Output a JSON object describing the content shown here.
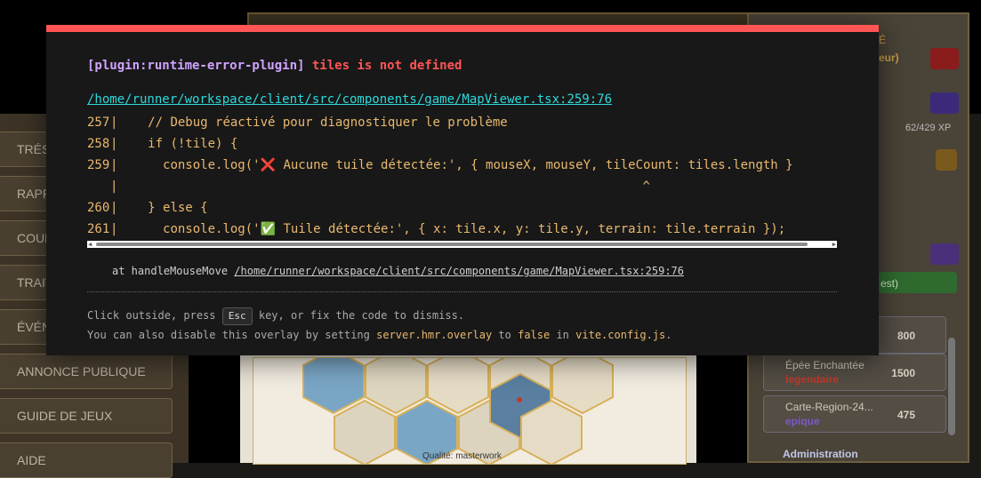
{
  "overlay": {
    "plugin": "[plugin:runtime-error-plugin]",
    "message": "tiles is not defined",
    "file": "/home/runner/workspace/client/src/components/game/MapViewer.tsx:259:76",
    "code_lines": [
      {
        "num": "257",
        "text": "    // Debug réactivé pour diagnostiquer le problème"
      },
      {
        "num": "258",
        "text": "    if (!tile) {"
      },
      {
        "num": "259",
        "text": "      console.log('❌ Aucune tuile détectée:', { mouseX, mouseY, tileCount: tiles.length }"
      },
      {
        "num": "",
        "text": "                                                                      ^"
      },
      {
        "num": "260",
        "text": "    } else {"
      },
      {
        "num": "261",
        "text": "      console.log('✅ Tuile détectée:', { x: tile.x, y: tile.y, terrain: tile.terrain });"
      }
    ],
    "stack_prefix": "at handleMouseMove",
    "stack_link": "/home/runner/workspace/client/src/components/game/MapViewer.tsx:259:76",
    "tip_line1_a": "Click outside, press",
    "tip_key": "Esc",
    "tip_line1_b": "key, or fix the code to dismiss.",
    "tip_line2_a": "You can also disable this overlay by setting",
    "tip_setting": "server.hmr.overlay",
    "tip_to": "to",
    "tip_false": "false",
    "tip_in": "in",
    "tip_config": "vite.config.js",
    "tip_end": "."
  },
  "background": {
    "left_nav": [
      "TRÉSO",
      "RAPP",
      "COUR",
      "TRAIT",
      "ÉVÉN",
      "ANNONCE PUBLIQUE",
      "GUIDE DE JEUX",
      "AIDE"
    ],
    "right_header_frag1": "É",
    "right_header_frag2": "eur)",
    "xp": "62/429 XP",
    "quest_frag": "est)",
    "items": [
      {
        "name": "",
        "rarity": "",
        "price": "800"
      },
      {
        "name": "Épée Enchantée",
        "rarity": "legendaire",
        "price": "1500"
      },
      {
        "name": "Carte-Region-24...",
        "rarity": "epique",
        "price": "475"
      }
    ],
    "admin": "Administration",
    "caption": "Qualité: masterwork"
  },
  "colors": {
    "error_red": "#ff5555",
    "plugin_purple": "#cfa4ff",
    "link_cyan": "#2dd9da",
    "code_yellow": "#e9b96e",
    "overlay_bg": "#181818"
  }
}
